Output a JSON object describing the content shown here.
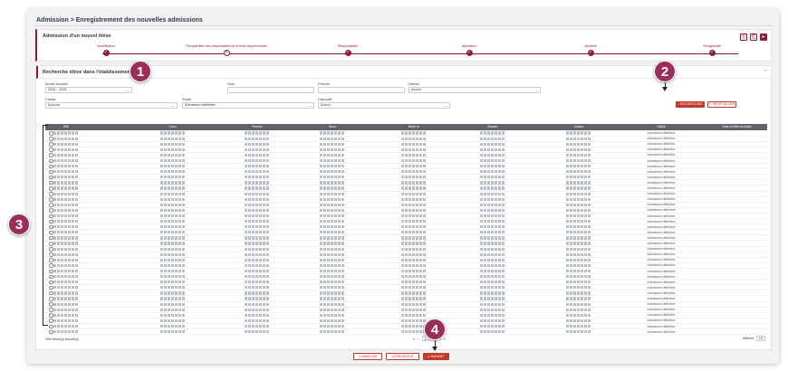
{
  "breadcrumb": "Admission > Enregistrement des nouvelles admissions",
  "new_student": {
    "title": "Admission d'un nouvel élève",
    "window_buttons": [
      "⎘",
      "⎗",
      "▸"
    ],
    "steps": [
      {
        "label": "Identification",
        "icon": "✓",
        "done": true
      },
      {
        "label": "Récupération des responsables de la fiche biopédommée",
        "icon": "✎",
        "done": false
      },
      {
        "label": "Responsables",
        "icon": "✓",
        "done": true
      },
      {
        "label": "Admission",
        "icon": "✓",
        "done": true
      },
      {
        "label": "Scolarité",
        "icon": "✓",
        "done": true
      },
      {
        "label": "Récapitulatif",
        "icon": "✓",
        "done": true
      }
    ]
  },
  "search": {
    "title": "Recherche élève dans l'établissement",
    "collapse": "–",
    "fields": {
      "annee": {
        "label": "Année scolaire",
        "value": "2024 - 2025"
      },
      "nom": {
        "label": "Nom",
        "value": ""
      },
      "prenom": {
        "label": "Prénom",
        "value": ""
      },
      "niveau": {
        "label": "Niveau",
        "value": "Aucun"
      },
      "classe": {
        "label": "Classe",
        "value": "Aucune"
      },
      "statut": {
        "label": "Statut",
        "value": "Admission définitive"
      },
      "dispositif": {
        "label": "Dispositif",
        "value": "Aucun"
      }
    },
    "search_button": "RECHERCHER",
    "reset_button": "RÉINITIALISER"
  },
  "table": {
    "columns": [
      "INE",
      "Nom",
      "Prénom",
      "Sexe",
      "Né(e) le",
      "Niveau",
      "Classe",
      "Statut",
      "Date d'effet du statut"
    ],
    "row_status": "Admission définitive",
    "row_count": 37,
    "result_count": "206 élève(s) trouvé(s)"
  },
  "pager": {
    "first": "«",
    "prev": "‹",
    "page": "1",
    "of": "/21",
    "next": "›",
    "last": "»"
  },
  "perpage": {
    "label": "Afficher",
    "value": "10"
  },
  "footer": {
    "cancel": "✕ ANNULER",
    "previous": "◂ PRÉCÉDENT",
    "next": "▸ SUIVANT"
  },
  "annotations": [
    "1",
    "2",
    "3",
    "4"
  ]
}
